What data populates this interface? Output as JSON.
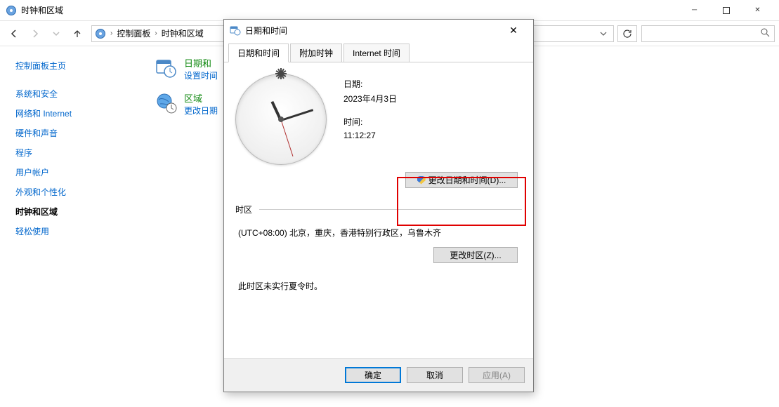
{
  "explorer": {
    "title": "时钟和区域",
    "breadcrumb": {
      "item1": "控制面板",
      "item2": "时钟和区域"
    },
    "search_placeholder": ""
  },
  "sidebar": {
    "home": "控制面板主页",
    "items": [
      "系统和安全",
      "网络和 Internet",
      "硬件和声音",
      "程序",
      "用户帐户",
      "外观和个性化",
      "时钟和区域",
      "轻松使用"
    ]
  },
  "content": {
    "datetime_group": {
      "title": "日期和",
      "desc": "设置时间"
    },
    "region_group": {
      "title": "区域",
      "desc": "更改日期"
    }
  },
  "dialog": {
    "title": "日期和时间",
    "tabs": [
      "日期和时间",
      "附加时钟",
      "Internet 时间"
    ],
    "date_label": "日期:",
    "date_value": "2023年4月3日",
    "time_label": "时间:",
    "time_value": "11:12:27",
    "change_datetime_btn": "更改日期和时间(D)...",
    "tz_header": "时区",
    "tz_value": "(UTC+08:00) 北京，重庆，香港特别行政区，乌鲁木齐",
    "change_tz_btn": "更改时区(Z)...",
    "dst_note": "此时区未实行夏令时。",
    "ok": "确定",
    "cancel": "取消",
    "apply": "应用(A)"
  }
}
